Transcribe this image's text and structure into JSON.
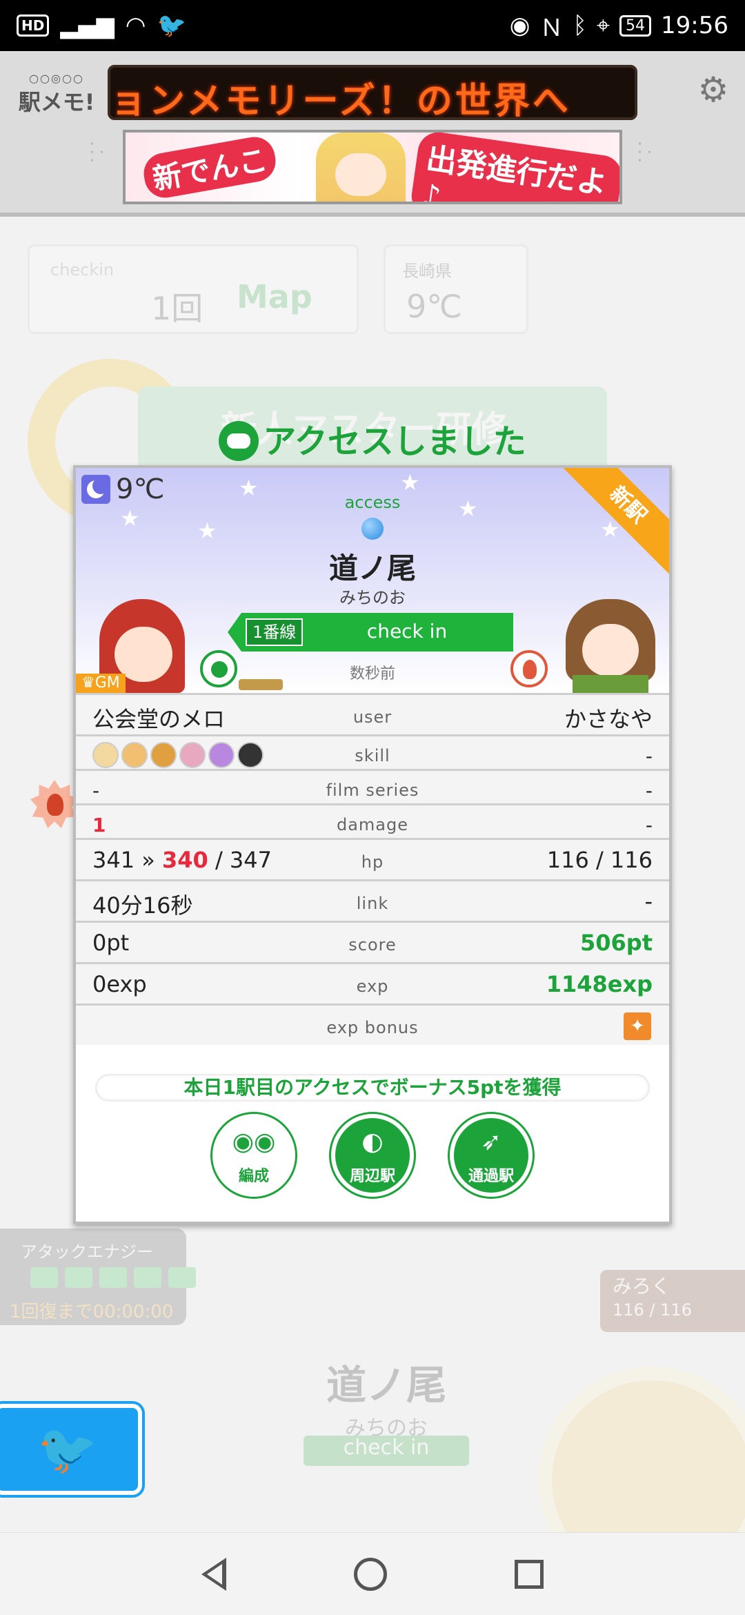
{
  "status_bar": {
    "left_badge": "HD",
    "battery": "54",
    "time": "19:56"
  },
  "header": {
    "logo_text": "駅メモ!",
    "ticker": "ョンメモリーズ！の世界へ",
    "banner_left": "新でんこ",
    "banner_right": "出発進行だよ♪"
  },
  "background": {
    "checkin_label": "checkin",
    "checkin_count": "1回",
    "map_label": "Map",
    "pref": "長崎県",
    "pref_temp": "9℃",
    "training": "新人マスター研修",
    "energy_title": "アタックエナジー",
    "energy_recover": "1回復まで00:00:00",
    "bg_station": "道ノ尾",
    "bg_kana": "みちのお",
    "bg_checkin": "check in",
    "bg_partner": "みろく",
    "bg_partner_hp": "116 / 116"
  },
  "dialog": {
    "title": "アクセスしました",
    "temp": "9℃",
    "new_ribbon": "新駅",
    "access_label": "access",
    "station_name": "道ノ尾",
    "station_kana": "みちのお",
    "line_label": "1番線",
    "checkin_label": "check in",
    "time_ago": "数秒前",
    "gm_badge": "GM",
    "rows": {
      "user": {
        "left": "公会堂のメロ",
        "label": "user",
        "right": "かさなや"
      },
      "skill": {
        "label": "skill",
        "right": "-"
      },
      "film": {
        "left": "-",
        "label": "film series",
        "right": "-"
      },
      "damage": {
        "left": "1",
        "label": "damage",
        "right": "-"
      },
      "hp": {
        "left_prefix": "341 » ",
        "left_now": "340",
        "left_suffix": " / 347",
        "label": "hp",
        "right": "116 / 116"
      },
      "link": {
        "left": "40分16秒",
        "label": "link",
        "right": "-"
      },
      "score": {
        "left": "0pt",
        "label": "score",
        "right": "506pt"
      },
      "exp": {
        "left": "0exp",
        "label": "exp",
        "right": "1148exp"
      },
      "expbonus": {
        "label": "exp bonus"
      }
    },
    "bonus_message": "本日1駅目のアクセスでボーナス5ptを獲得",
    "actions": {
      "formation": "編成",
      "nearby": "周辺駅",
      "passed": "通過駅"
    }
  },
  "colors": {
    "accent_green": "#1ca33a",
    "damage_red": "#e8283b",
    "twitter_blue": "#1aa1f2",
    "ribbon_orange": "#f8a51a"
  }
}
